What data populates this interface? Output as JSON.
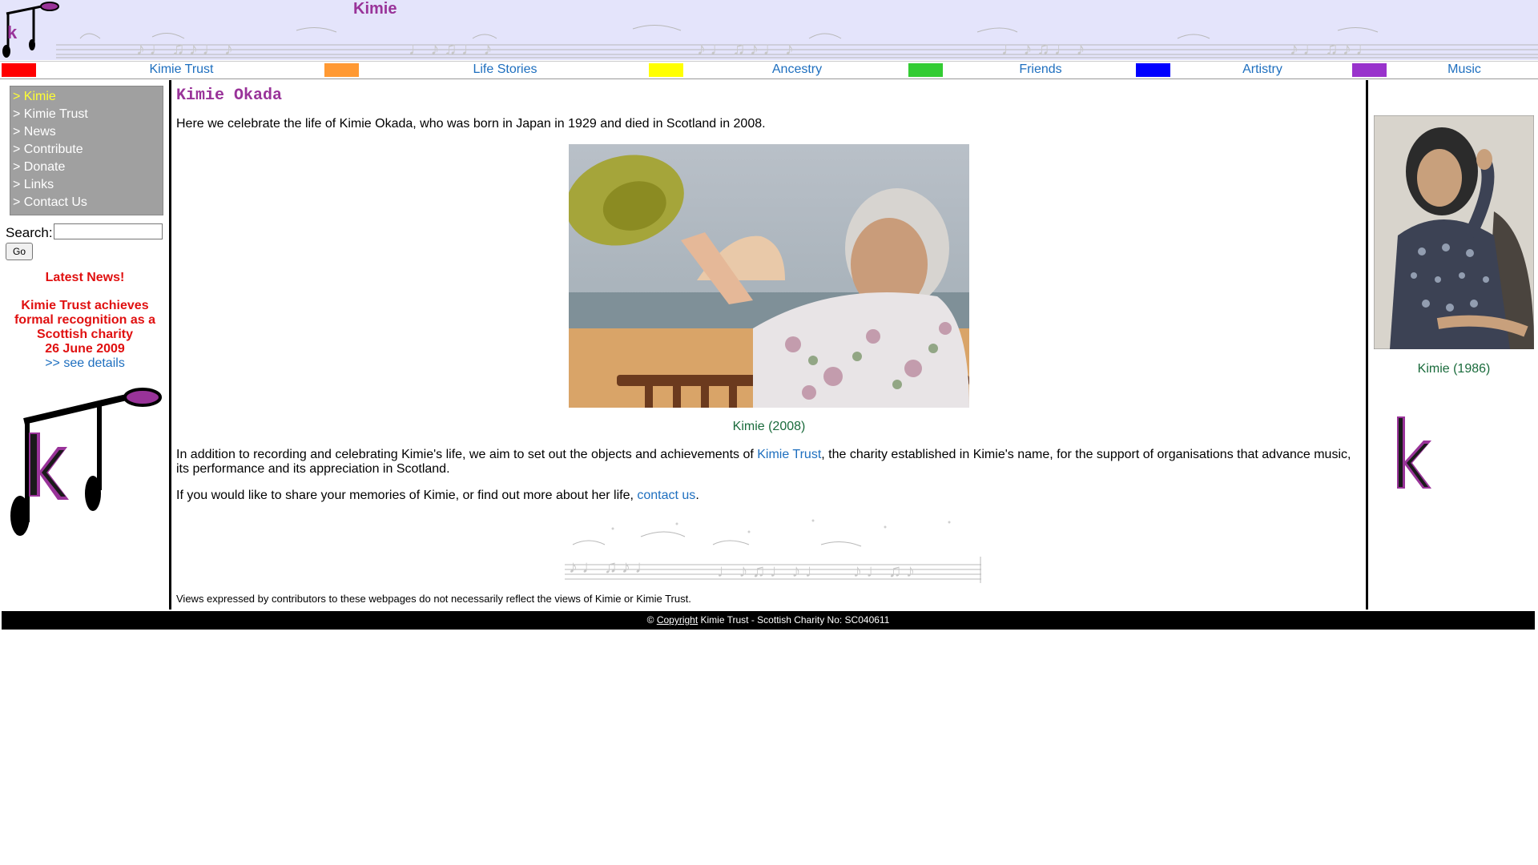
{
  "site": {
    "title": "Kimie"
  },
  "nav": {
    "items": [
      {
        "label": "Kimie Trust",
        "color": "#ff0000"
      },
      {
        "label": "Life Stories",
        "color": "#ff9933"
      },
      {
        "label": "Ancestry",
        "color": "#ffff00"
      },
      {
        "label": "Friends",
        "color": "#33cc33"
      },
      {
        "label": "Artistry",
        "color": "#0000ff"
      },
      {
        "label": "Music",
        "color": "#9933cc"
      }
    ]
  },
  "sidebar": {
    "menu": [
      "> Kimie",
      "> Kimie Trust",
      "> News",
      "> Contribute",
      "> Donate",
      "> Links",
      "> Contact Us"
    ],
    "search_label": "Search:",
    "search_value": "",
    "go_label": "Go",
    "news": {
      "heading": "Latest News!",
      "line1": "Kimie Trust achieves",
      "line2": "formal recognition as a",
      "line3": "Scottish charity",
      "date": "26 June 2009",
      "link": ">> see details"
    }
  },
  "main": {
    "title": "Kimie Okada",
    "intro": "Here we celebrate the life of Kimie Okada, who was born in Japan in 1929 and died in Scotland in 2008.",
    "photo_caption": "Kimie (2008)",
    "para2_before": "In addition to recording and celebrating Kimie's life, we aim to set out the objects and achievements of ",
    "para2_link": "Kimie Trust",
    "para2_after": ", the charity established in Kimie's name, for the support of organisations that advance music, its performance and its appreciation in Scotland.",
    "para3_before": "If you would like to share your memories of Kimie, or find out more about her life, ",
    "para3_link": "contact us",
    "para3_after": ".",
    "disclaimer": "Views expressed by contributors to these webpages do not necessarily reflect the views of Kimie or Kimie Trust."
  },
  "right": {
    "photo_caption": "Kimie (1986)"
  },
  "footer": {
    "copy_symbol": "©",
    "copyright_link": "Copyright",
    "text": " Kimie Trust - Scottish Charity No: SC040611"
  },
  "colors": {
    "accent_purple": "#993399",
    "link_blue": "#1e6fbf",
    "caption_green": "#1a6b3c",
    "news_red": "#e01010"
  }
}
